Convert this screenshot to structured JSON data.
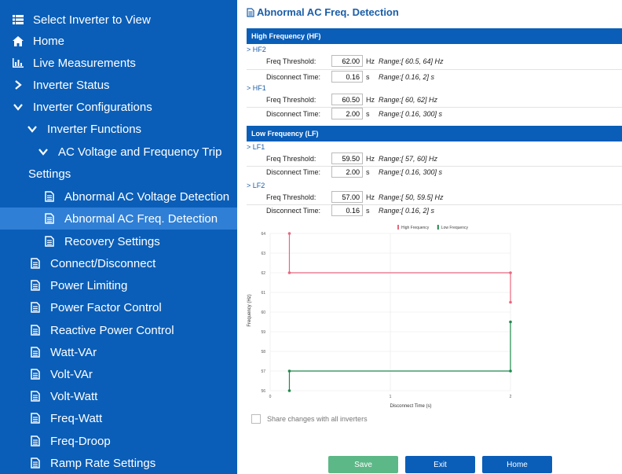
{
  "sidebar": {
    "select_inverter": "Select Inverter to View",
    "home": "Home",
    "live": "Live Measurements",
    "status": "Inverter Status",
    "configs": "Inverter Configurations",
    "functions": "Inverter Functions",
    "acvft": "AC Voltage and Frequency Trip",
    "settings": "Settings",
    "abn_voltage": "Abnormal AC Voltage Detection",
    "abn_freq": "Abnormal AC Freq. Detection",
    "recovery": "Recovery Settings",
    "connect": "Connect/Disconnect",
    "power_limiting": "Power Limiting",
    "pf": "Power Factor Control",
    "reactive": "Reactive Power Control",
    "watt_var": "Watt-VAr",
    "volt_var": "Volt-VAr",
    "volt_watt": "Volt-Watt",
    "freq_watt": "Freq-Watt",
    "freq_droop": "Freq-Droop",
    "ramp": "Ramp Rate Settings"
  },
  "main": {
    "title": "Abnormal AC Freq. Detection",
    "hf": {
      "header": "High Frequency (HF)",
      "hf2": {
        "label": "> HF2",
        "freq_label": "Freq Threshold:",
        "freq_value": "62.00",
        "freq_unit": "Hz",
        "freq_range": "Range:[ 60.5, 64] Hz",
        "time_label": "Disconnect Time:",
        "time_value": "0.16",
        "time_unit": "s",
        "time_range": "Range:[ 0.16, 2] s"
      },
      "hf1": {
        "label": "> HF1",
        "freq_label": "Freq Threshold:",
        "freq_value": "60.50",
        "freq_unit": "Hz",
        "freq_range": "Range:[ 60, 62] Hz",
        "time_label": "Disconnect Time:",
        "time_value": "2.00",
        "time_unit": "s",
        "time_range": "Range:[ 0.16, 300] s"
      }
    },
    "lf": {
      "header": "Low Frequency (LF)",
      "lf1": {
        "label": "> LF1",
        "freq_label": "Freq Threshold:",
        "freq_value": "59.50",
        "freq_unit": "Hz",
        "freq_range": "Range:[ 57, 60] Hz",
        "time_label": "Disconnect Time:",
        "time_value": "2.00",
        "time_unit": "s",
        "time_range": "Range:[ 0.16, 300] s"
      },
      "lf2": {
        "label": "> LF2",
        "freq_label": "Freq Threshold:",
        "freq_value": "57.00",
        "freq_unit": "Hz",
        "freq_range": "Range:[ 50, 59.5] Hz",
        "time_label": "Disconnect Time:",
        "time_value": "0.16",
        "time_unit": "s",
        "time_range": "Range:[ 0.16, 2] s"
      }
    },
    "share_label": "Share changes with all inverters",
    "buttons": {
      "save": "Save",
      "exit": "Exit",
      "home": "Home"
    }
  },
  "colors": {
    "sidebar": "#0a5eb8",
    "active": "#2f7fd6",
    "high": "#e8677f",
    "low": "#1f8a4c",
    "save": "#5cb887",
    "primary": "#0a5eb8"
  },
  "chart_data": {
    "type": "line",
    "xlabel": "Disconnect Time (s)",
    "ylabel": "Frequency (Hz)",
    "xlim": [
      0,
      2
    ],
    "ylim": [
      56,
      64
    ],
    "xticks": [
      "0",
      "1",
      "2"
    ],
    "yticks": [
      "56",
      "57",
      "58",
      "59",
      "60",
      "61",
      "62",
      "63",
      "64"
    ],
    "legend_position": "top",
    "series": [
      {
        "name": "High Frequency",
        "color": "#e8677f",
        "points": [
          [
            0.16,
            64
          ],
          [
            0.16,
            62
          ],
          [
            2,
            62
          ],
          [
            2,
            60.5
          ]
        ]
      },
      {
        "name": "Low Frequency",
        "color": "#1f8a4c",
        "points": [
          [
            0.16,
            56
          ],
          [
            0.16,
            57
          ],
          [
            2,
            57
          ],
          [
            2,
            59.5
          ]
        ]
      }
    ]
  }
}
